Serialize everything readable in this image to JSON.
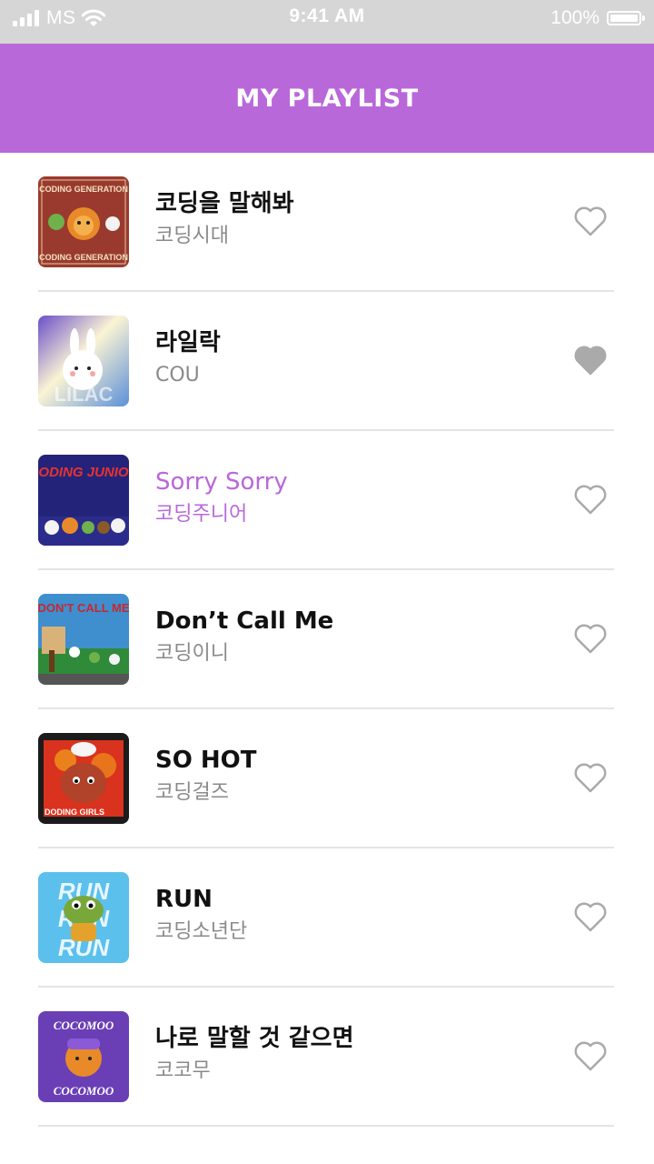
{
  "status_bar": {
    "carrier": "MS",
    "time": "9:41 AM",
    "battery": "100%",
    "battery_level": 1.0
  },
  "header": {
    "title": "MY PLAYLIST"
  },
  "colors": {
    "accent": "#b968da",
    "heart_outline": "#aaaaaa",
    "heart_filled": "#aaaaaa"
  },
  "tracks": [
    {
      "title": "코딩을 말해봐",
      "artist": "코딩시대",
      "liked": false,
      "active": false,
      "cover_text": "CODING GENERATION"
    },
    {
      "title": "라일락",
      "artist": "COU",
      "liked": true,
      "active": false,
      "cover_text": "LILAC"
    },
    {
      "title": "Sorry Sorry",
      "artist": "코딩주니어",
      "liked": false,
      "active": true,
      "cover_text": "CODING JUNIOR"
    },
    {
      "title": "Don’t Call Me",
      "artist": "코딩이니",
      "liked": false,
      "active": false,
      "cover_text": "DON'T CALL ME"
    },
    {
      "title": "SO HOT",
      "artist": "코딩걸즈",
      "liked": false,
      "active": false,
      "cover_text": "DODING GIRLS"
    },
    {
      "title": "RUN",
      "artist": "코딩소년단",
      "liked": false,
      "active": false,
      "cover_text": "RUN"
    },
    {
      "title": "나로 말할 것 같으면",
      "artist": "코코무",
      "liked": false,
      "active": false,
      "cover_text": "COCOMOO"
    }
  ]
}
